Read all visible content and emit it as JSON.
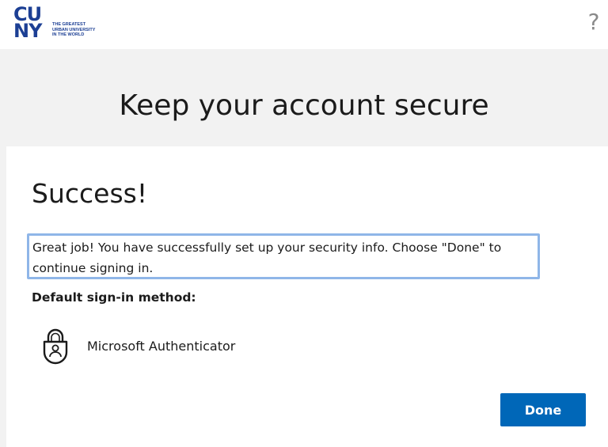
{
  "header": {
    "logo": {
      "wordmark_line1": "CU",
      "wordmark_line2": "NY",
      "tagline_lines": [
        "THE GREATEST",
        "URBAN UNIVERSITY",
        "IN THE WORLD"
      ],
      "color": "#1c3f94"
    },
    "help_icon": "help-icon",
    "help_glyph": "?"
  },
  "page": {
    "title": "Keep your account secure"
  },
  "card": {
    "heading": "Success!",
    "message": "Great job! You have successfully set up your security info. Choose \"Done\" to continue signing in.",
    "default_method_label": "Default sign-in method:",
    "method": {
      "icon": "authenticator-lock-icon",
      "name": "Microsoft Authenticator"
    },
    "done_button": "Done"
  },
  "colors": {
    "accent": "#0067b8",
    "highlight_border": "#8fb6e8",
    "background": "#f2f2f2"
  }
}
